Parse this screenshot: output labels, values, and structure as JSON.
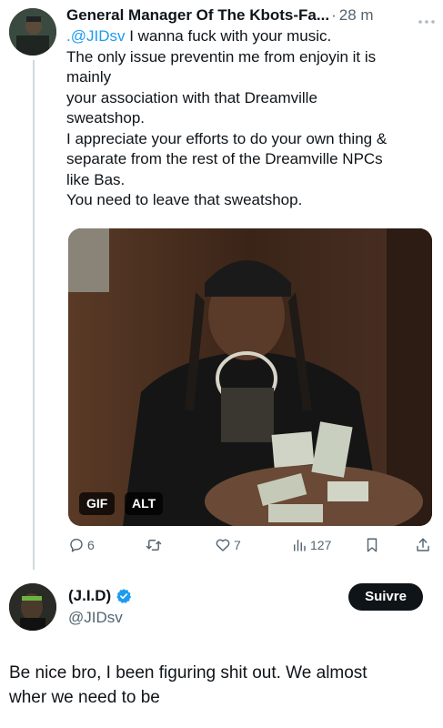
{
  "tweet": {
    "author_name": "General Manager Of The Kbots-Fa...",
    "separator": "·",
    "time": "28 m",
    "more_icon": "ellipsis-icon",
    "mention": ".@JIDsv",
    "lines": [
      " I wanna fuck with your music.",
      "The only issue preventin me from enjoyin it is",
      "mainly",
      "your association with that Dreamville",
      "sweatshop.",
      "I appreciate your efforts to do your own thing &",
      "separate from the rest of the Dreamville NPCs",
      "like Bas.",
      "You need to leave that sweatshop."
    ],
    "media": {
      "gif_label": "GIF",
      "alt_label": "ALT"
    },
    "actions": {
      "replies": "6",
      "retweets": "",
      "likes": "7",
      "views": "127"
    }
  },
  "reply": {
    "author_name": "(J.I.D)",
    "handle": "@JIDsv",
    "follow_label": "Suivre",
    "lines": [
      "Be nice bro,  I been figuring shit out. We almost",
      "wher we need to be"
    ]
  },
  "colors": {
    "accent": "#1d9bf0",
    "text": "#0f1419",
    "muted": "#536471",
    "line": "#cfd9de"
  }
}
